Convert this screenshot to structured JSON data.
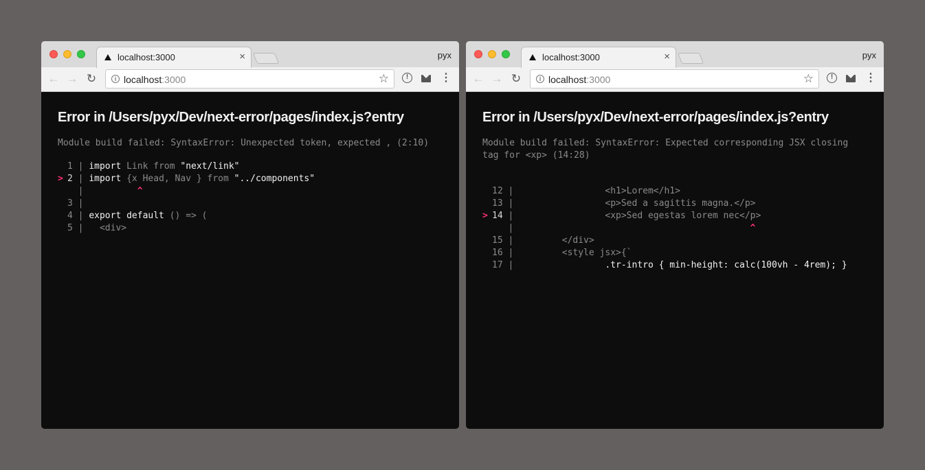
{
  "windows": [
    {
      "tab_title": "localhost:3000",
      "tab_close": "×",
      "profile": "pyx",
      "url_host": "localhost",
      "url_port": ":3000",
      "error_title": "Error in /Users/pyx/Dev/next-error/pages/index.js?entry",
      "error_message": "Module build failed: SyntaxError: Unexpected token, expected , (2:10)"
    },
    {
      "tab_title": "localhost:3000",
      "tab_close": "×",
      "profile": "pyx",
      "url_host": "localhost",
      "url_port": ":3000",
      "error_title": "Error in /Users/pyx/Dev/next-error/pages/index.js?entry",
      "error_message": "Module build failed: SyntaxError: Expected corresponding JSX closing\ntag for <xp> (14:28)"
    }
  ],
  "icons": {
    "back": "arrow-left-icon",
    "forward": "arrow-right-icon",
    "reload": "reload-icon",
    "info": "info-icon",
    "star": "star-icon",
    "extension": "extension-icon",
    "mail": "mail-icon",
    "menu": "kebab-menu-icon"
  },
  "colors": {
    "background": "#656060",
    "content_bg": "#0d0d0d",
    "marker": "#ff2e75"
  },
  "code_frames": [
    {
      "gutter_width": 1,
      "lines": [
        {
          "marker": "",
          "num": "1",
          "sep": " | ",
          "segments": [
            [
              "kw",
              "import"
            ],
            [
              "dim",
              " Link from "
            ],
            [
              "str",
              "\"next/link\""
            ]
          ]
        },
        {
          "marker": ">",
          "num": "2",
          "sep": " | ",
          "highlight": true,
          "segments": [
            [
              "kw",
              "import"
            ],
            [
              "dim",
              " {x Head, Nav } from "
            ],
            [
              "str",
              "\"../components\""
            ]
          ]
        },
        {
          "marker": "",
          "num": "",
          "sep": "   | ",
          "segments": [
            [
              "caret",
              "         ^"
            ]
          ]
        },
        {
          "marker": "",
          "num": "3",
          "sep": " | ",
          "segments": []
        },
        {
          "marker": "",
          "num": "4",
          "sep": " | ",
          "segments": [
            [
              "kw",
              "export default"
            ],
            [
              "dim",
              " () => ("
            ]
          ]
        },
        {
          "marker": "",
          "num": "5",
          "sep": " | ",
          "segments": [
            [
              "dim",
              "  <div>"
            ]
          ]
        }
      ]
    },
    {
      "gutter_width": 2,
      "lines": [
        {
          "marker": "",
          "num": "",
          "sep": "",
          "segments": []
        },
        {
          "marker": "",
          "num": "12",
          "sep": " | ",
          "segments": [
            [
              "dim",
              "                <h1>Lorem</h1>"
            ]
          ]
        },
        {
          "marker": "",
          "num": "13",
          "sep": " | ",
          "segments": [
            [
              "dim",
              "                <p>Sed a sagittis magna.</p>"
            ]
          ]
        },
        {
          "marker": ">",
          "num": "14",
          "sep": " | ",
          "highlight": true,
          "segments": [
            [
              "dim",
              "                <xp>Sed egestas lorem nec</p>"
            ]
          ]
        },
        {
          "marker": "",
          "num": "",
          "sep": "    | ",
          "segments": [
            [
              "caret",
              "                                           ^"
            ]
          ]
        },
        {
          "marker": "",
          "num": "15",
          "sep": " | ",
          "segments": [
            [
              "dim",
              "        </div>"
            ]
          ]
        },
        {
          "marker": "",
          "num": "16",
          "sep": " | ",
          "segments": [
            [
              "dim",
              "        <style jsx>{`"
            ]
          ]
        },
        {
          "marker": "",
          "num": "17",
          "sep": " | ",
          "segments": [
            [
              "kw",
              "                .tr-intro { min-height: calc(100vh - 4rem); }"
            ]
          ]
        }
      ]
    }
  ]
}
